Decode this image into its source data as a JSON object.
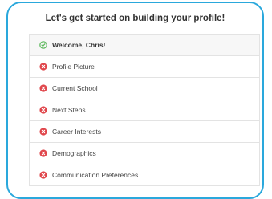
{
  "header": {
    "title": "Let's get started on building your profile!"
  },
  "steps": [
    {
      "label": "Welcome, Chris!",
      "status": "complete",
      "icon": "check-circle-icon"
    },
    {
      "label": "Profile Picture",
      "status": "incomplete",
      "icon": "x-circle-icon"
    },
    {
      "label": "Current School",
      "status": "incomplete",
      "icon": "x-circle-icon"
    },
    {
      "label": "Next Steps",
      "status": "incomplete",
      "icon": "x-circle-icon"
    },
    {
      "label": "Career Interests",
      "status": "incomplete",
      "icon": "x-circle-icon"
    },
    {
      "label": "Demographics",
      "status": "incomplete",
      "icon": "x-circle-icon"
    },
    {
      "label": "Communication Preferences",
      "status": "incomplete",
      "icon": "x-circle-icon"
    }
  ],
  "colors": {
    "accent_border": "#2aa8dc",
    "complete": "#5cb85c",
    "incomplete": "#e0464b"
  }
}
